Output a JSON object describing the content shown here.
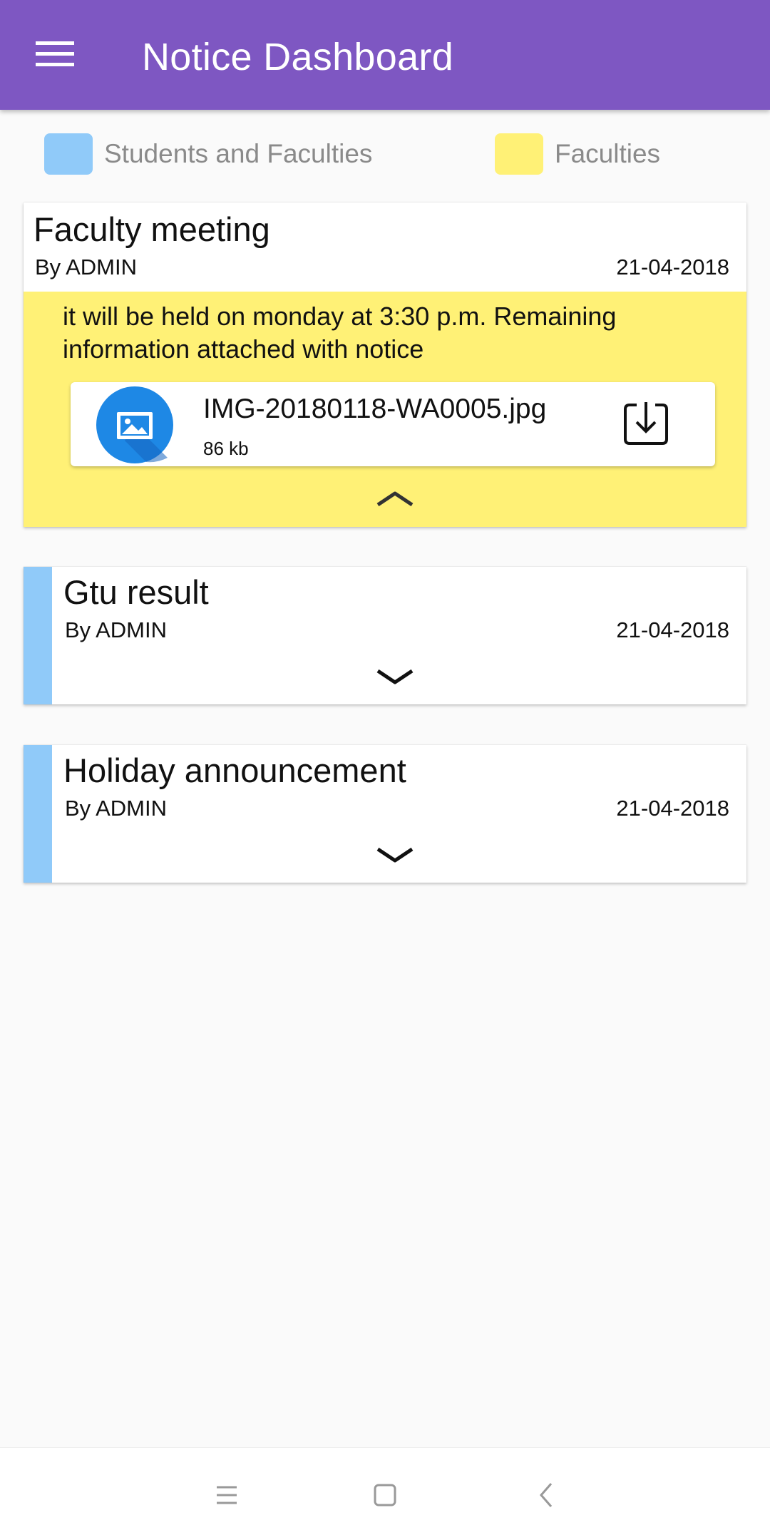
{
  "app_bar": {
    "title": "Notice Dashboard",
    "menu_icon": "hamburger-menu-icon",
    "color": "#7e57c2"
  },
  "legend": [
    {
      "label": "Students and Faculties",
      "color": "#90caf9"
    },
    {
      "label": "Faculties",
      "color": "#fff176"
    }
  ],
  "notices": [
    {
      "title": "Faculty meeting",
      "author": "By ADMIN",
      "date": "21-04-2018",
      "expanded": true,
      "body": "it will be held on monday at 3:30 p.m. Remaining information attached with notice",
      "attachment": {
        "name": "IMG-20180118-WA0005.jpg",
        "size": "86 kb",
        "icon": "image-file-icon",
        "action_icon": "download-icon"
      },
      "toggle_icon": "chevron-up-icon",
      "color": "#fff176"
    },
    {
      "title": "Gtu result",
      "author": "By ADMIN",
      "date": "21-04-2018",
      "expanded": false,
      "toggle_icon": "chevron-down-icon",
      "color": "#90caf9"
    },
    {
      "title": "Holiday announcement",
      "author": "By ADMIN",
      "date": "21-04-2018",
      "expanded": false,
      "toggle_icon": "chevron-down-icon",
      "color": "#90caf9"
    }
  ],
  "nav_bar": {
    "icons": [
      "recent-apps-icon",
      "home-icon",
      "back-icon"
    ]
  }
}
